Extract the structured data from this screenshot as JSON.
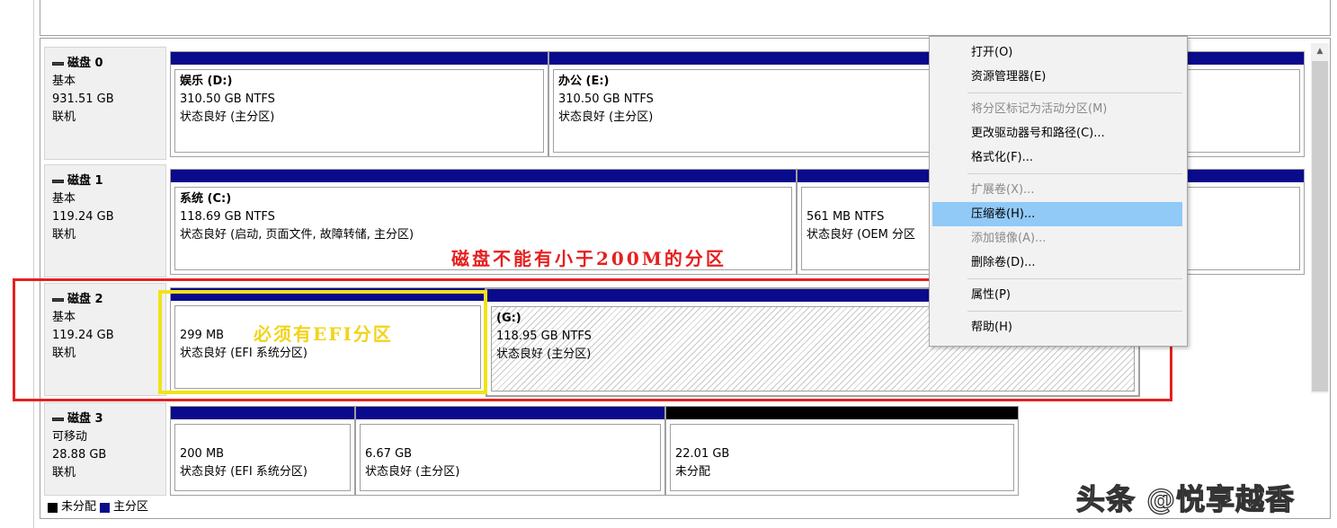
{
  "disks": [
    {
      "name": "磁盘 0",
      "type": "基本",
      "size": "931.51 GB",
      "status": "联机"
    },
    {
      "name": "磁盘 1",
      "type": "基本",
      "size": "119.24 GB",
      "status": "联机"
    },
    {
      "name": "磁盘 2",
      "type": "基本",
      "size": "119.24 GB",
      "status": "联机"
    },
    {
      "name": "磁盘 3",
      "type": "可移动",
      "size": "28.88 GB",
      "status": "联机"
    }
  ],
  "partitions": {
    "d0p1": {
      "title": "娱乐 (D:)",
      "size": "310.50 GB NTFS",
      "state": "状态良好 (主分区)"
    },
    "d0p2": {
      "title": "办公 (E:)",
      "size": "310.50 GB NTFS",
      "state": "状态良好 (主分区)"
    },
    "d1p1": {
      "title": "系统 (C:)",
      "size": "118.69 GB NTFS",
      "state": "状态良好 (启动, 页面文件, 故障转储, 主分区)"
    },
    "d1p2": {
      "title": "",
      "size": "561 MB NTFS",
      "state": "状态良好 (OEM 分区"
    },
    "d2p1": {
      "title": "",
      "size": "299 MB",
      "state": "状态良好 (EFI 系统分区)"
    },
    "d2p2": {
      "title": "(G:)",
      "size": "118.95 GB NTFS",
      "state": "状态良好 (主分区)"
    },
    "d3p1": {
      "title": "",
      "size": "200 MB",
      "state": "状态良好 (EFI 系统分区)"
    },
    "d3p2": {
      "title": "",
      "size": "6.67 GB",
      "state": "状态良好 (主分区)"
    },
    "d3p3": {
      "title": "",
      "size": "22.01 GB",
      "state": "未分配"
    }
  },
  "annotations": {
    "red": "磁盘不能有小于200M的分区",
    "yellow": "必须有EFI分区"
  },
  "legend": {
    "unallocated": "未分配",
    "primary": "主分区"
  },
  "context_menu": {
    "open": "打开(O)",
    "explorer": "资源管理器(E)",
    "mark_active": "将分区标记为活动分区(M)",
    "change_letter": "更改驱动器号和路径(C)...",
    "format": "格式化(F)...",
    "extend": "扩展卷(X)...",
    "shrink": "压缩卷(H)...",
    "add_mirror": "添加镜像(A)...",
    "delete": "删除卷(D)...",
    "properties": "属性(P)",
    "help": "帮助(H)"
  },
  "watermark": "头条 @悦享越香",
  "colors": {
    "primary_partition": "#0a0a8c",
    "unallocated": "#000000",
    "menu_highlight": "#91c9f7",
    "annotation_red": "#e52020",
    "annotation_yellow": "#f2e21a"
  }
}
